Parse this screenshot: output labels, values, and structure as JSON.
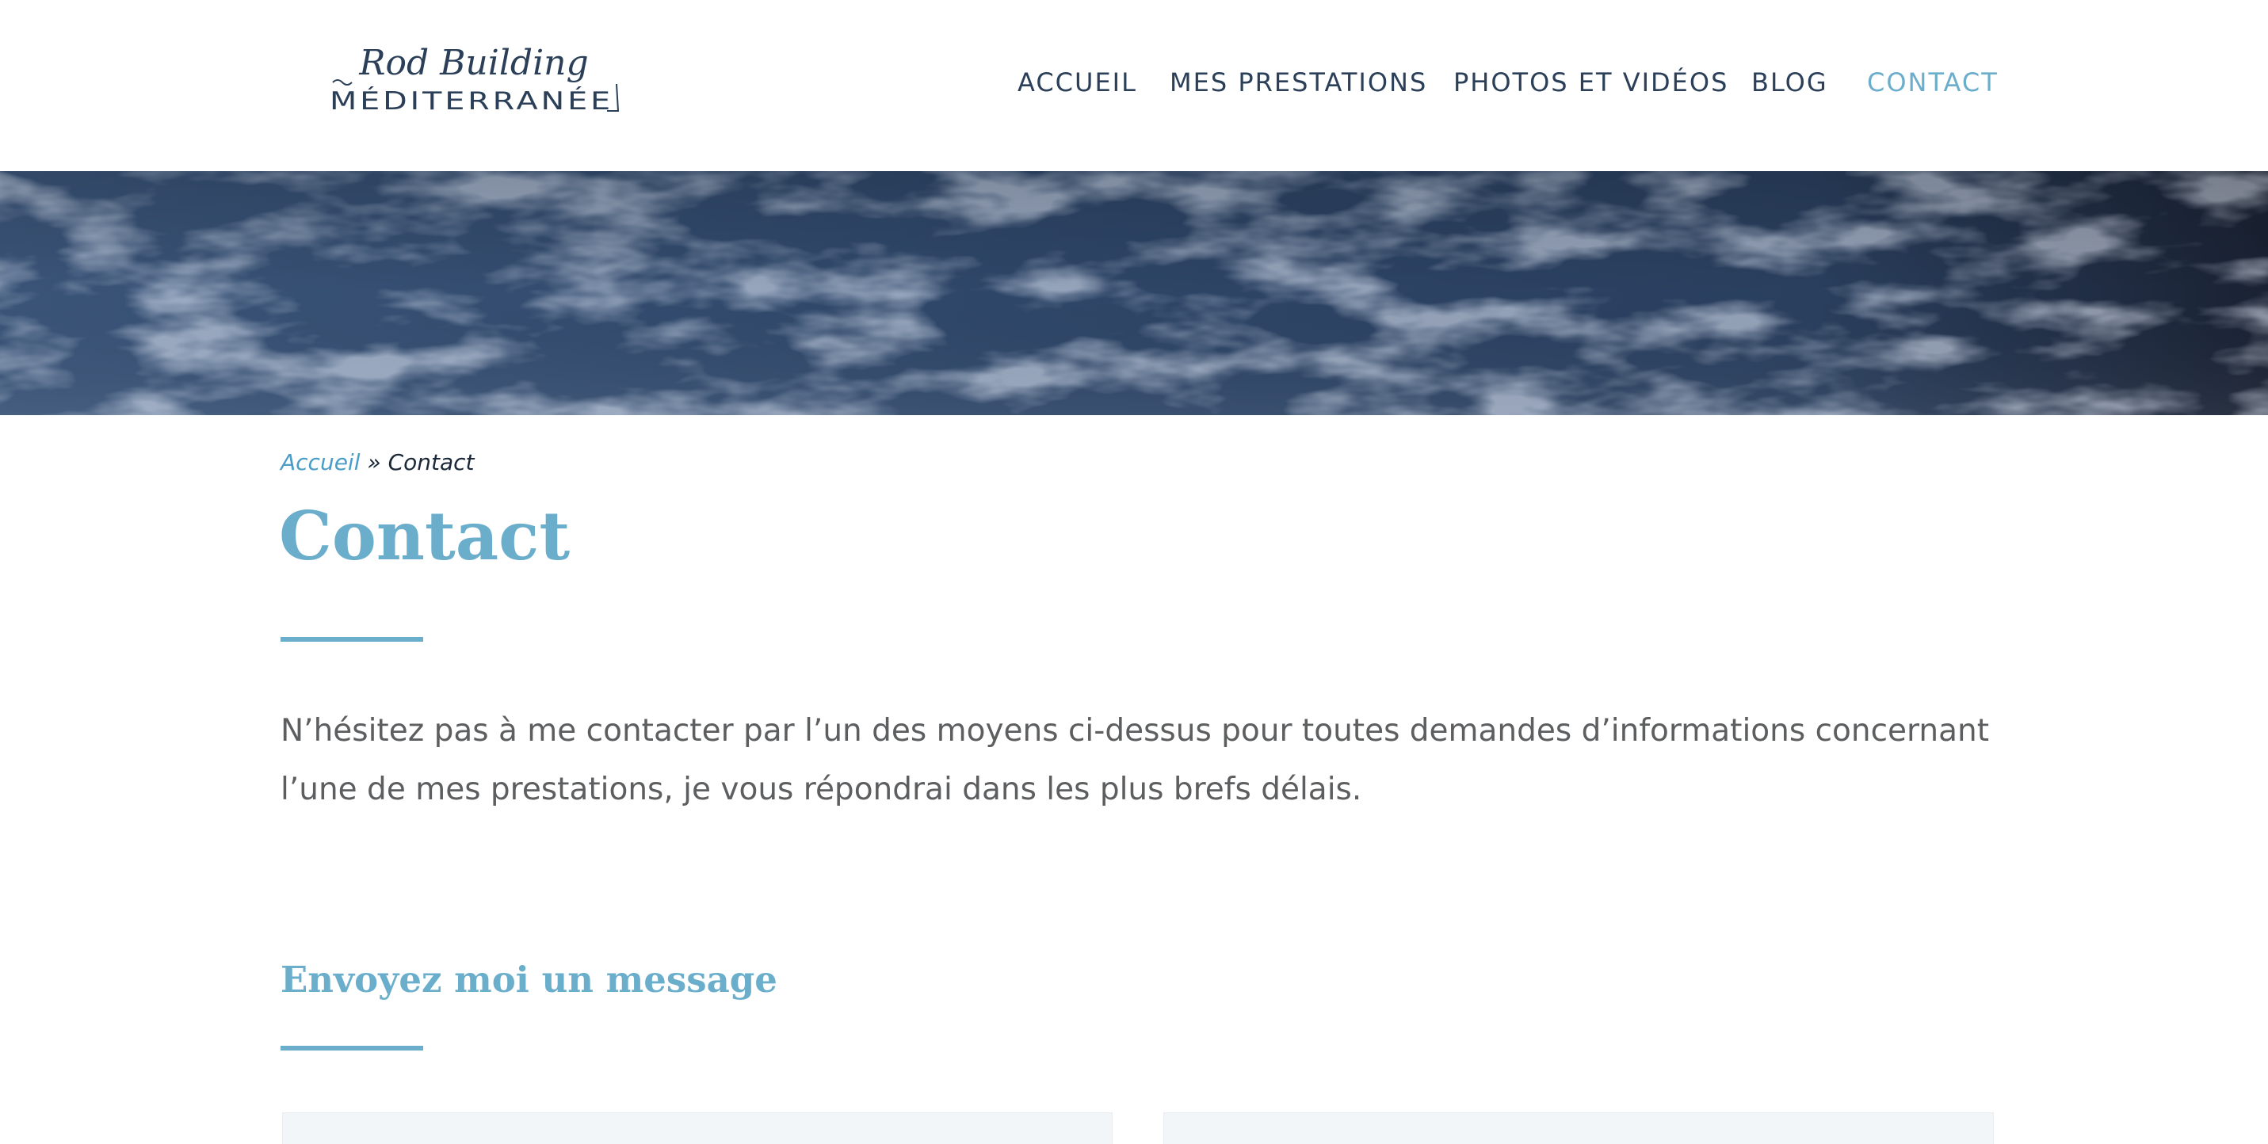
{
  "brand": {
    "logo_line1": "Rod Building",
    "logo_line2": "MÉDITERRANÉE",
    "accent_color": "#6aaecb",
    "nav_color": "#2b4058"
  },
  "nav": {
    "items": [
      {
        "label": "ACCUEIL",
        "active": false
      },
      {
        "label": "MES PRESTATIONS",
        "active": false
      },
      {
        "label": "PHOTOS ET VIDÉOS",
        "active": false
      },
      {
        "label": "BLOG",
        "active": false
      },
      {
        "label": "CONTACT",
        "active": true
      }
    ]
  },
  "breadcrumb": {
    "home": "Accueil",
    "separator": "»",
    "current": "Contact"
  },
  "page": {
    "title": "Contact",
    "intro": "N’hésitez pas à me contacter par l’un des moyens ci-dessus pour toutes demandes d’informations concernant l’une de mes prestations, je vous répondrai dans les plus brefs délais."
  },
  "form_section": {
    "title": "Envoyez moi un message"
  }
}
